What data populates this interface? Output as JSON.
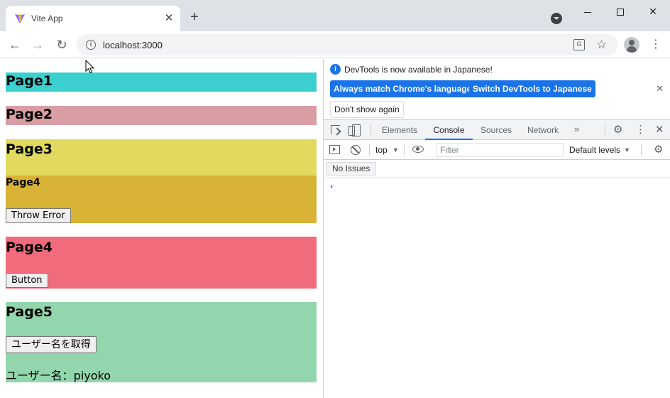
{
  "browser": {
    "tab_title": "Vite App",
    "tab_close": "✕",
    "new_tab": "+",
    "url": "localhost:3000"
  },
  "page": {
    "page1_title": "Page1",
    "page2_title": "Page2",
    "page3_title": "Page3",
    "page4_inner_title": "Page4",
    "throw_error_label": "Throw Error",
    "page4_title": "Page4",
    "button_label": "Button",
    "page5_title": "Page5",
    "get_username_label": "ユーザー名を取得",
    "username_text": "ユーザー名：piyoko"
  },
  "devtools": {
    "infobar_text": "DevTools is now available in Japanese!",
    "match_language_label": "Always match Chrome's language",
    "switch_language_label": "Switch DevTools to Japanese",
    "dont_show_label": "Don't show again",
    "tabs": {
      "elements": "Elements",
      "console": "Console",
      "sources": "Sources",
      "network": "Network"
    },
    "more_tabs": "»",
    "context": "top",
    "filter_placeholder": "Filter",
    "levels": "Default levels",
    "no_issues": "No Issues",
    "prompt": "›"
  },
  "colors": {
    "page1": "#3bcfcf",
    "page2": "#d99da4",
    "page3": "#e2d95f",
    "page4_inner": "#d9b336",
    "page4": "#f06b7c",
    "page5": "#93d6ad",
    "devtools_accent": "#1a73e8"
  }
}
